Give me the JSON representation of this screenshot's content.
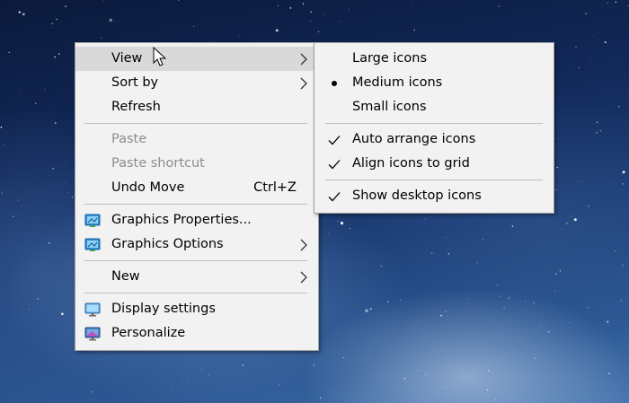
{
  "context_menu": {
    "items": [
      {
        "label": "View",
        "has_submenu": true,
        "highlighted": true
      },
      {
        "label": "Sort by",
        "has_submenu": true
      },
      {
        "label": "Refresh"
      },
      {
        "label": "Paste",
        "disabled": true
      },
      {
        "label": "Paste shortcut",
        "disabled": true
      },
      {
        "label": "Undo Move",
        "shortcut": "Ctrl+Z"
      },
      {
        "label": "Graphics Properties...",
        "icon": "graphics-icon"
      },
      {
        "label": "Graphics Options",
        "icon": "graphics-icon",
        "has_submenu": true
      },
      {
        "label": "New",
        "has_submenu": true
      },
      {
        "label": "Display settings",
        "icon": "monitor-icon"
      },
      {
        "label": "Personalize",
        "icon": "personalize-icon"
      }
    ]
  },
  "view_submenu": {
    "items": [
      {
        "label": "Large icons"
      },
      {
        "label": "Medium icons",
        "mark": "bullet-icon"
      },
      {
        "label": "Small icons"
      },
      {
        "label": "Auto arrange icons",
        "mark": "checkmark-icon"
      },
      {
        "label": "Align icons to grid",
        "mark": "checkmark-icon"
      },
      {
        "label": "Show desktop icons",
        "mark": "checkmark-icon"
      }
    ]
  },
  "colors": {
    "menu_background": "#f2f2f2",
    "highlight": "#d9d9d9",
    "disabled_text": "#8c8c8c",
    "separator": "#bdbdbd"
  }
}
